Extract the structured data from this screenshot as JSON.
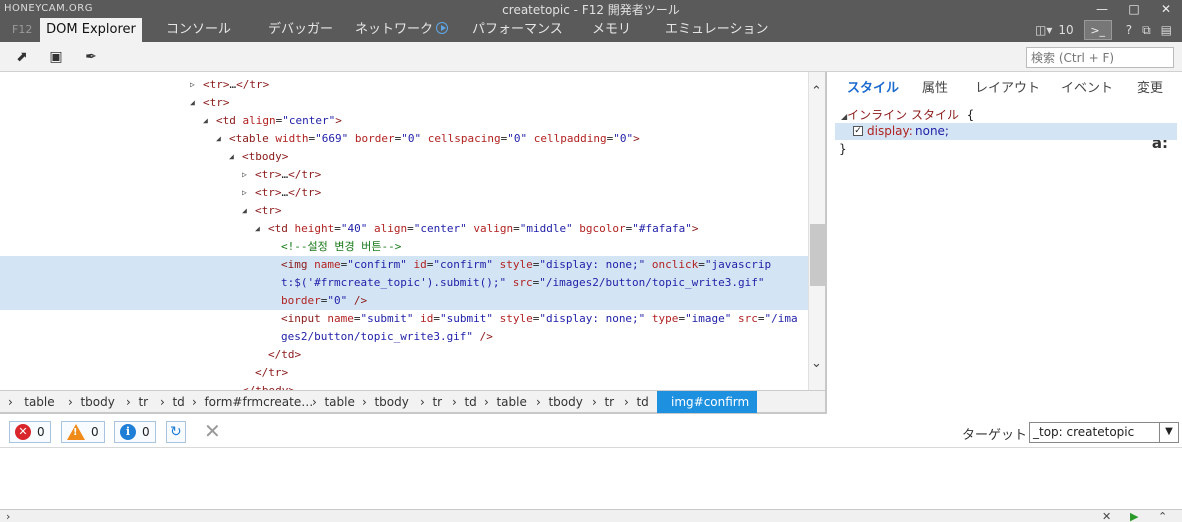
{
  "watermark": "HONEYCAM.ORG",
  "window_title": "createtopic - F12 開発者ツール",
  "tabs": {
    "f12": "F12",
    "dom_explorer": "DOM Explorer",
    "console": "コンソール",
    "debugger": "デバッガー",
    "network": "ネットワーク",
    "performance": "パフォーマンス",
    "memory": "メモリ",
    "emulation": "エミュレーション"
  },
  "toolbar_right": {
    "target_count": "10",
    "help": "?"
  },
  "search": {
    "placeholder": "検索 (Ctrl + F)"
  },
  "dom_lines": [
    {
      "t1": "<tr>",
      "t2": "…",
      "t3": "</tr>"
    },
    {
      "t1": "<tr>"
    },
    {
      "tag": "<td",
      "a1": " align",
      "v1": "\"center\"",
      "end": ">"
    },
    {
      "tag": "<table",
      "a1": " width",
      "v1": "\"669\"",
      "a2": " border",
      "v2": "\"0\"",
      "a3": " cellspacing",
      "v3": "\"0\"",
      "a4": " cellpadding",
      "v4": "\"0\"",
      "end": ">"
    },
    {
      "t1": "<tbody>"
    },
    {
      "t1": "<tr>",
      "t2": "…",
      "t3": "</tr>"
    },
    {
      "t1": "<tr>",
      "t2": "…",
      "t3": "</tr>"
    },
    {
      "t1": "<tr>"
    },
    {
      "tag": "<td",
      "a1": " height",
      "v1": "\"40\"",
      "a2": " align",
      "v2": "\"center\"",
      "a3": " valign",
      "v3": "\"middle\"",
      "a4": " bgcolor",
      "v4": "\"#fafafa\"",
      "end": ">"
    },
    {
      "comment": "<!--설정 변경 버튼-->"
    },
    {
      "tag": "<img",
      "a1": " name",
      "v1": "\"confirm\"",
      "a2": " id",
      "v2": "\"confirm\"",
      "a3": " style",
      "v3": "\"display: none;\"",
      "a4": " onclick",
      "v4": "\"javascrip"
    },
    {
      "v1": "t:$('#frmcreate_topic').submit();\"",
      "a2": " src",
      "v2": "\"/images2/button/topic_write3.gif\""
    },
    {
      "a1": "border",
      "v1": "\"0\"",
      "end": " />"
    },
    {
      "tag": "<input",
      "a1": " name",
      "v1": "\"submit\"",
      "a2": " id",
      "v2": "\"submit\"",
      "a3": " style",
      "v3": "\"display: none;\"",
      "a4": " type",
      "v4": "\"image\"",
      "a5": " src",
      "v5": "\"/ima"
    },
    {
      "v1": "ges2/button/topic_write3.gif\"",
      "end": " />"
    },
    {
      "t1": "</td>"
    },
    {
      "t1": "</tr>"
    },
    {
      "t1": "</tbody>"
    }
  ],
  "breadcrumbs": [
    "table",
    "tbody",
    "tr",
    "td",
    "form#frmcreate…",
    "table",
    "tbody",
    "tr",
    "td",
    "table",
    "tbody",
    "tr",
    "td",
    "img#confirm"
  ],
  "styles_pane": {
    "tabs": [
      "スタイル",
      "属性",
      "レイアウト",
      "イベント",
      "変更"
    ],
    "rule_header": "インライン スタイル",
    "open_brace": "{",
    "close_brace": "}",
    "property": "display:",
    "value": "none;",
    "az": "a:"
  },
  "console": {
    "errors": "0",
    "warnings": "0",
    "info": "0",
    "target_label": "ターゲット",
    "target_value": "_top: createtopic"
  }
}
